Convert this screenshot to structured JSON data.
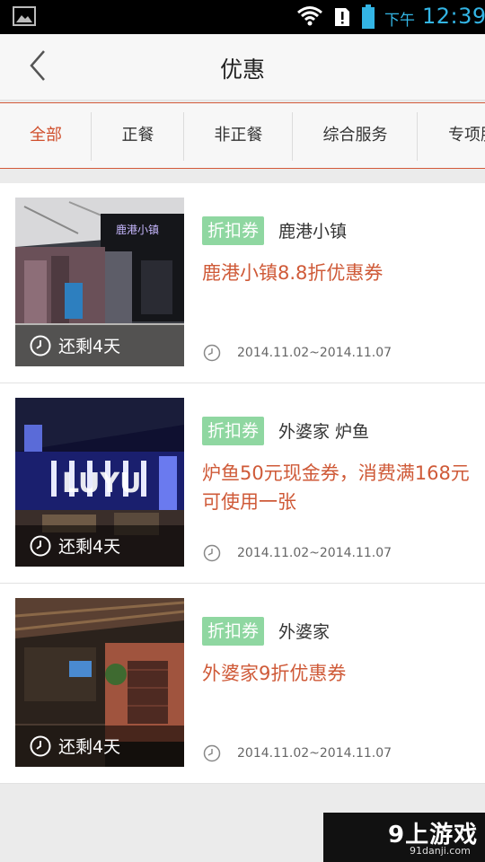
{
  "status_bar": {
    "ampm": "下午",
    "time": "12:39",
    "icons": [
      "gallery-icon",
      "wifi-icon",
      "alert-icon",
      "battery-icon"
    ],
    "accent_color": "#33b5e5"
  },
  "header": {
    "title": "优惠",
    "back_icon": "chevron-left-icon"
  },
  "tabs": [
    {
      "label": "全部",
      "active": true
    },
    {
      "label": "正餐",
      "active": false
    },
    {
      "label": "非正餐",
      "active": false
    },
    {
      "label": "综合服务",
      "active": false
    },
    {
      "label": "专项服",
      "active": false
    }
  ],
  "coupons": [
    {
      "badge": "折扣券",
      "merchant": "鹿港小镇",
      "offer": "鹿港小镇8.8折优惠券",
      "remaining": "还剩4天",
      "dates": "2014.11.02~2014.11.07",
      "image_sign": "鹿港小镇"
    },
    {
      "badge": "折扣券",
      "merchant": "外婆家 炉鱼",
      "offer": "炉鱼50元现金券，消费满168元可使用一张",
      "remaining": "还剩4天",
      "dates": "2014.11.02~2014.11.07",
      "image_sign": "LUYU"
    },
    {
      "badge": "折扣券",
      "merchant": "外婆家",
      "offer": "外婆家9折优惠券",
      "remaining": "还剩4天",
      "dates": "2014.11.02~2014.11.07",
      "image_sign": ""
    }
  ],
  "watermark": {
    "logo": "9上游戏",
    "url": "91danji.com"
  },
  "colors": {
    "accent": "#d0502e",
    "badge_bg": "#8fd7a1",
    "offer_text": "#cf5a38"
  }
}
